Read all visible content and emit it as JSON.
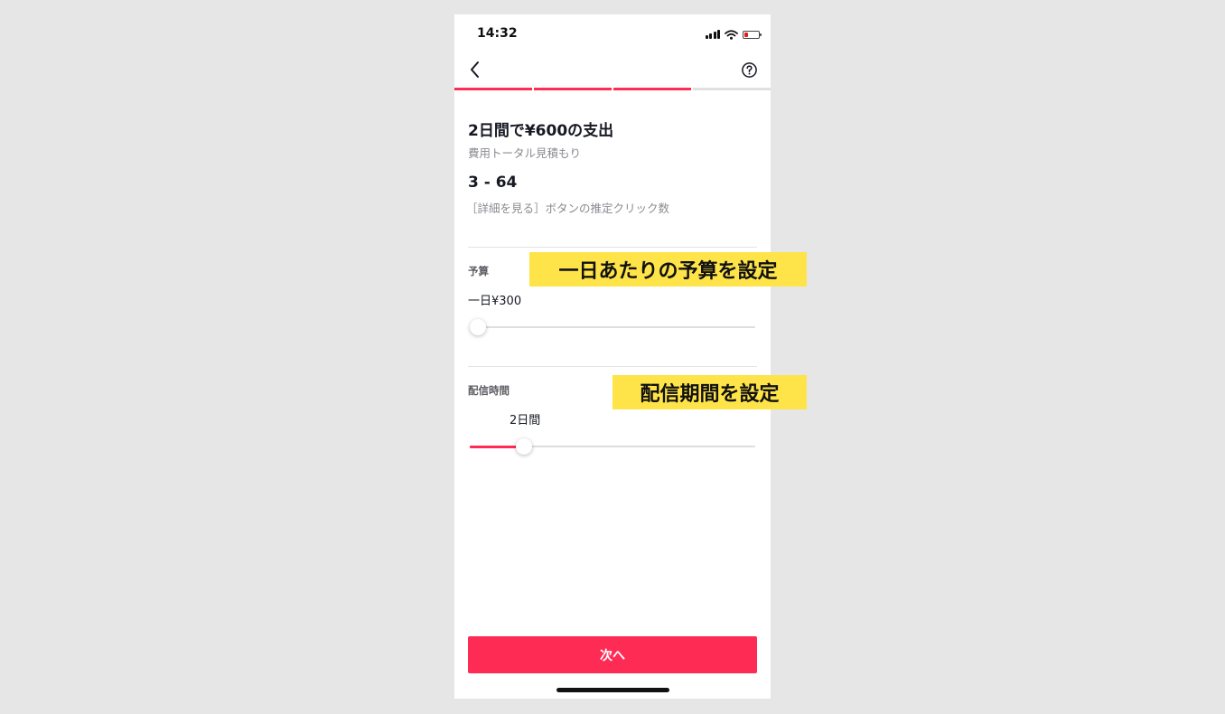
{
  "status_bar": {
    "time": "14:32"
  },
  "progress": {
    "total_steps": 4,
    "completed_steps": 3,
    "accent": "#fe2c55"
  },
  "summary": {
    "title": "2日間で¥600の支出",
    "subtitle": "費用トータル見積もり",
    "clicks_range": "3 - 64",
    "clicks_caption": "［詳細を見る］ボタンの推定クリック数"
  },
  "budget": {
    "label": "予算",
    "value_text": "一日¥300",
    "slider_fraction": 0.0
  },
  "duration": {
    "label": "配信時間",
    "value_text": "2日間",
    "slider_fraction": 0.19
  },
  "next_button": {
    "label": "次へ"
  },
  "annotations": {
    "budget_callout": "一日あたりの予算を設定",
    "duration_callout": "配信期間を設定",
    "highlight_color": "#fee449"
  },
  "icons": [
    "back-chevron-icon",
    "help-circle-icon",
    "signal-icon",
    "wifi-icon",
    "battery-icon"
  ]
}
